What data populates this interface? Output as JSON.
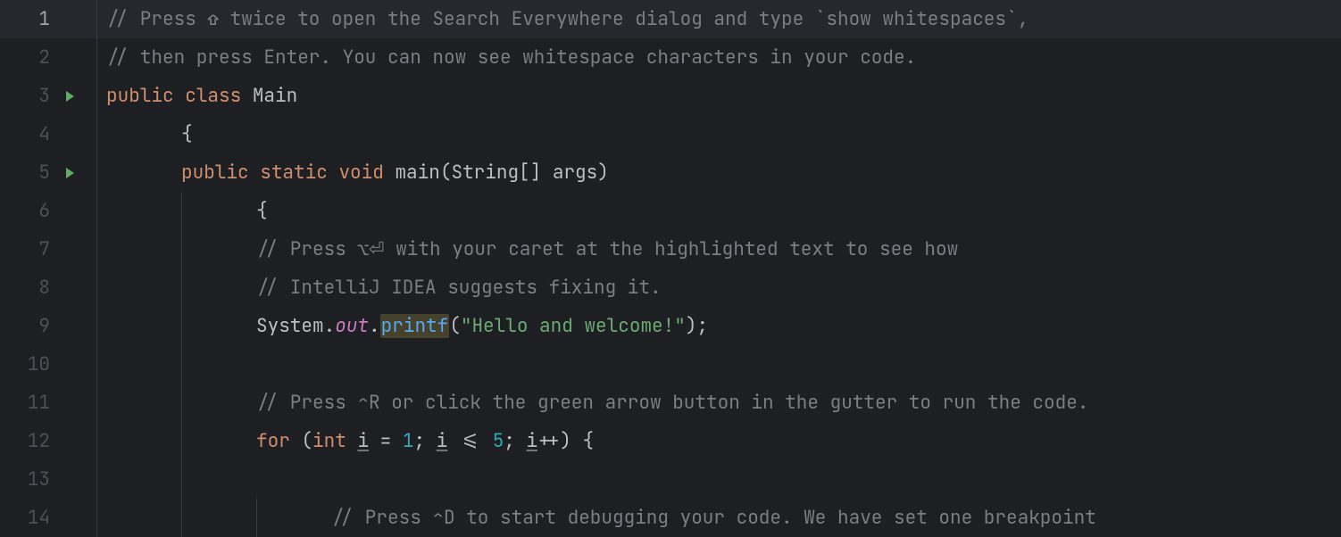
{
  "lines": {
    "l1": {
      "num": "1",
      "comment": "// Press ⇧ twice to open the Search Everywhere dialog and type `show whitespaces`,"
    },
    "l2": {
      "num": "2",
      "comment": "// then press Enter. You can now see whitespace characters in your code."
    },
    "l3": {
      "num": "3",
      "kw1": "public",
      "kw2": "class",
      "cls": "Main"
    },
    "l4": {
      "num": "4",
      "brace": "{"
    },
    "l5": {
      "num": "5",
      "kw1": "public",
      "kw2": "static",
      "kw3": "void",
      "method": "main",
      "sig1": "(String[] args)"
    },
    "l6": {
      "num": "6",
      "brace": "{"
    },
    "l7": {
      "num": "7",
      "comment": "// Press ⌥⏎ with your caret at the highlighted text to see how"
    },
    "l8": {
      "num": "8",
      "comment": "// IntelliJ IDEA suggests fixing it."
    },
    "l9": {
      "num": "9",
      "sys": "System",
      "dot1": ".",
      "out": "out",
      "dot2": ".",
      "printf": "printf",
      "open": "(",
      "str": "\"Hello and welcome!\"",
      "close": ");"
    },
    "l10": {
      "num": "10"
    },
    "l11": {
      "num": "11",
      "comment": "// Press ⌃R or click the green arrow button in the gutter to run the code."
    },
    "l12": {
      "num": "12",
      "for": "for",
      "open": " (",
      "int": "int",
      "sp1": " ",
      "i1": "i",
      "eq": " = ",
      "one": "1",
      "semi1": "; ",
      "i2": "i",
      "le": " <= ",
      "five": "5",
      "semi2": "; ",
      "i3": "i",
      "inc": "++) {"
    },
    "l13": {
      "num": "13"
    },
    "l14": {
      "num": "14",
      "comment": "// Press ⌃D to start debugging your code. We have set one breakpoint"
    }
  }
}
